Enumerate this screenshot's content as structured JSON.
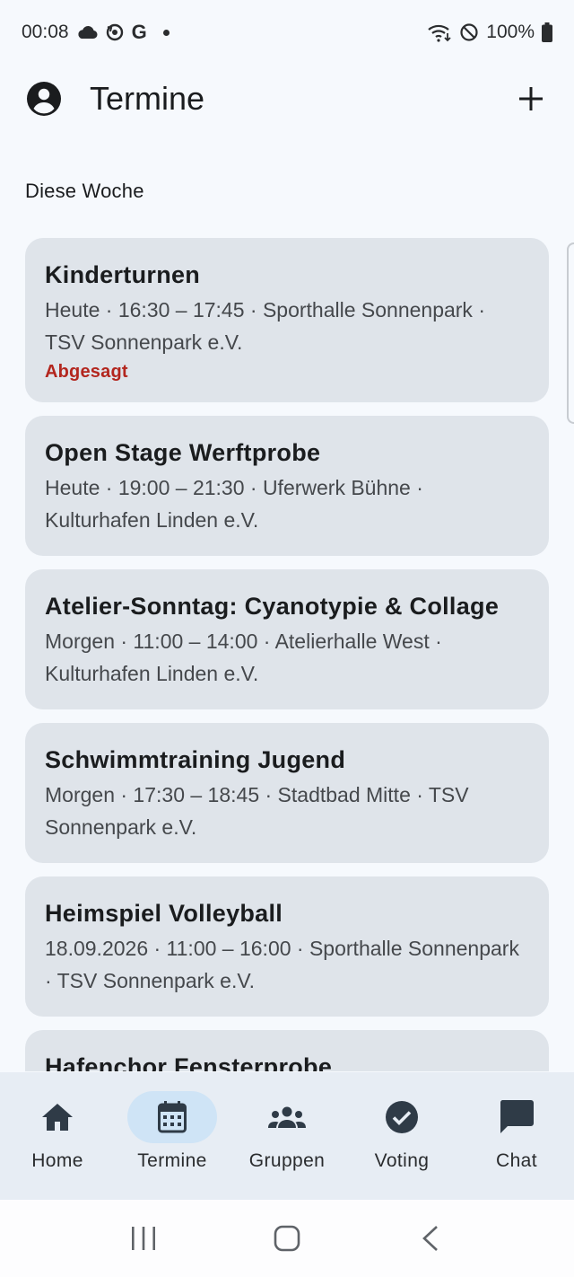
{
  "status_bar": {
    "time": "00:08",
    "battery": "100%",
    "google_letter": "G"
  },
  "app_bar": {
    "title": "Termine"
  },
  "section": {
    "title": "Diese Woche"
  },
  "events": [
    {
      "title": "Kinderturnen",
      "subtitle": "Heute · 16:30 – 17:45 · Sporthalle Sonnenpark · TSV Sonnenpark e.V.",
      "status": "Abgesagt"
    },
    {
      "title": "Open Stage Werftprobe",
      "subtitle": "Heute · 19:00 – 21:30 · Uferwerk Bühne · Kulturhafen Linden e.V."
    },
    {
      "title": "Atelier-Sonntag: Cyanotypie & Collage",
      "subtitle": "Morgen · 11:00 – 14:00 · Atelierhalle West · Kulturhafen Linden e.V."
    },
    {
      "title": "Schwimmtraining Jugend",
      "subtitle": "Morgen · 17:30 – 18:45 · Stadtbad Mitte · TSV Sonnenpark e.V."
    },
    {
      "title": "Heimspiel Volleyball",
      "subtitle": "18.09.2026 · 11:00 – 16:00 · Sporthalle Sonnenpark · TSV Sonnenpark e.V."
    },
    {
      "title": "Hafenchor Fensterprobe",
      "subtitle": ""
    }
  ],
  "bottom_nav": [
    {
      "label": "Home",
      "icon": "home-icon",
      "active": false
    },
    {
      "label": "Termine",
      "icon": "calendar-icon",
      "active": true
    },
    {
      "label": "Gruppen",
      "icon": "groups-icon",
      "active": false
    },
    {
      "label": "Voting",
      "icon": "check-circle-icon",
      "active": false
    },
    {
      "label": "Chat",
      "icon": "chat-icon",
      "active": false
    }
  ],
  "colors": {
    "background": "#f6f9fd",
    "card": "#dfe4ea",
    "status_cancelled": "#b3261e",
    "nav_background": "#e7edf4",
    "nav_active_pill": "#cfe4f6"
  }
}
